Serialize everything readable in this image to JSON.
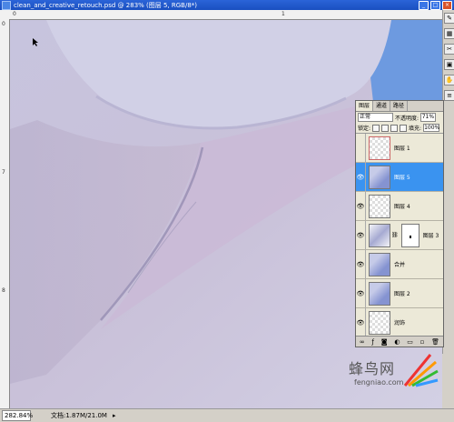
{
  "window": {
    "title": "clean_and_creative_retouch.psd @ 283% (图层 5, RGB/8*)",
    "buttons": [
      "_",
      "□",
      "×"
    ]
  },
  "rulers": {
    "top_ticks": [
      "0",
      "1"
    ],
    "left_ticks": [
      "0",
      "7",
      "8"
    ]
  },
  "right_toolbar": {
    "icons": [
      "brush-icon",
      "swatch-icon",
      "scissors-icon",
      "stamp-icon",
      "hand-icon",
      "layers-icon"
    ]
  },
  "layers_panel": {
    "tabs": [
      "图层",
      "通道",
      "路径"
    ],
    "blend_mode": "正常",
    "opacity_label": "不透明度:",
    "opacity_value": "71%",
    "lock_label": "锁定:",
    "fill_label": "填充:",
    "fill_value": "100%",
    "layers": [
      {
        "name": "图层 1",
        "visible": false,
        "selected": false
      },
      {
        "name": "图层 5",
        "visible": true,
        "selected": true
      },
      {
        "name": "图层 4",
        "visible": true,
        "selected": false
      },
      {
        "name": "图层 3",
        "visible": true,
        "selected": false
      },
      {
        "name": "合并",
        "visible": true,
        "selected": false
      },
      {
        "name": "图层 2",
        "visible": true,
        "selected": false
      },
      {
        "name": "润饰",
        "visible": true,
        "selected": false
      }
    ]
  },
  "status": {
    "zoom": "282.84%",
    "doc": "文档:1.87M/21.0M"
  },
  "watermark": {
    "brand": "蜂鸟网",
    "url": "fengniao.com"
  },
  "colors": {
    "selection": "#3a93f0",
    "canvas": "#cdc9df",
    "sky": "#6d9ae0"
  }
}
